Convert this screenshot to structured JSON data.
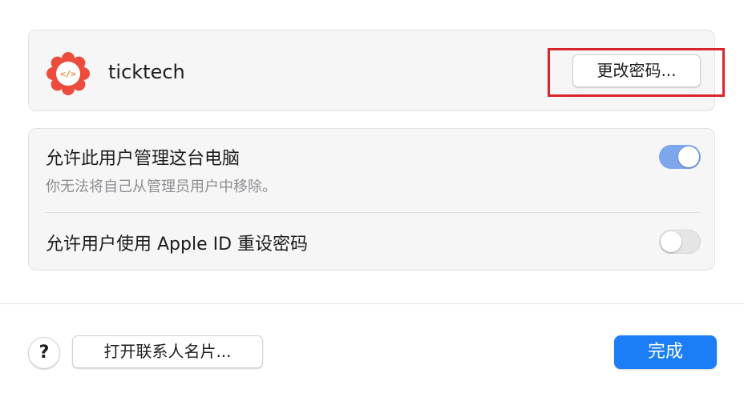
{
  "user": {
    "name": "ticktech",
    "avatar_icon": "code-badge-icon",
    "avatar_glyph": "</>",
    "avatar_color": "#ec4c3c",
    "change_password_label": "更改密码..."
  },
  "settings": {
    "admin": {
      "title": "允许此用户管理这台电脑",
      "subtitle": "你无法将自己从管理员用户中移除。",
      "enabled": true
    },
    "apple_id_reset": {
      "title": "允许用户使用 Apple ID 重设密码",
      "enabled": false
    }
  },
  "footer": {
    "help_label": "?",
    "open_contact_label": "打开联系人名片...",
    "done_label": "完成"
  },
  "colors": {
    "accent": "#1b7ef7",
    "toggle_on": "#7ea6ea",
    "highlight_box": "#d8262c"
  }
}
